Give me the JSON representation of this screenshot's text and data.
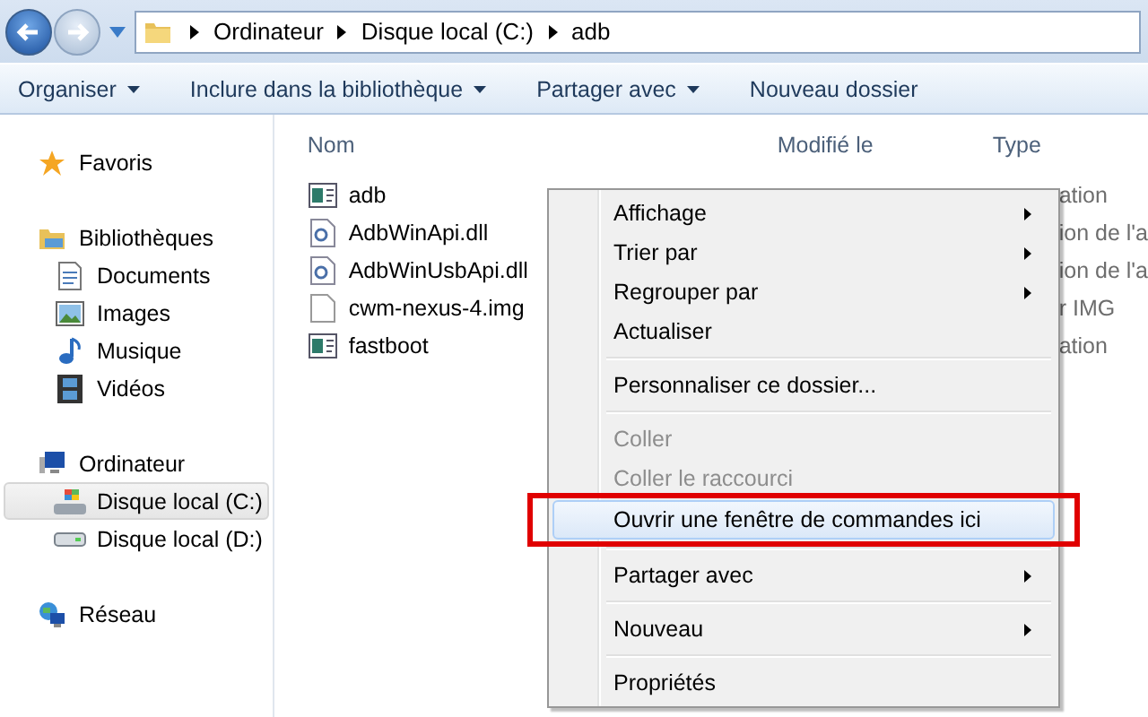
{
  "address_bar": {
    "crumbs": [
      "Ordinateur",
      "Disque local (C:)",
      "adb"
    ]
  },
  "toolbar": [
    {
      "label": "Organiser",
      "dropdown": true
    },
    {
      "label": "Inclure dans la bibliothèque",
      "dropdown": true
    },
    {
      "label": "Partager avec",
      "dropdown": true
    },
    {
      "label": "Nouveau dossier",
      "dropdown": false
    }
  ],
  "sidebar": {
    "groups": [
      {
        "label": "Favoris"
      },
      {
        "label": "Bibliothèques",
        "children": [
          {
            "label": "Documents",
            "selected": false
          },
          {
            "label": "Images",
            "selected": false
          },
          {
            "label": "Musique",
            "selected": false
          },
          {
            "label": "Vidéos",
            "selected": false
          }
        ]
      },
      {
        "label": "Ordinateur",
        "children": [
          {
            "label": "Disque local (C:)",
            "selected": true
          },
          {
            "label": "Disque local (D:)",
            "selected": false
          }
        ]
      },
      {
        "label": "Réseau"
      }
    ]
  },
  "table": {
    "columns": [
      "Nom",
      "Modifié le",
      "Type"
    ],
    "rows": [
      {
        "name": "adb",
        "kind": "application",
        "type": "ation"
      },
      {
        "name": "AdbWinApi.dll",
        "kind": "library",
        "type": "ion de l'a"
      },
      {
        "name": "AdbWinUsbApi.dll",
        "kind": "library",
        "type": "ion de l'a"
      },
      {
        "name": "cwm-nexus-4.img",
        "kind": "file",
        "type": "r IMG"
      },
      {
        "name": "fastboot",
        "kind": "application",
        "type": "ation"
      }
    ]
  },
  "context_menu": [
    {
      "kind": "item",
      "label": "Affichage",
      "submenu": true,
      "disabled": false,
      "selected": false,
      "annotated": false
    },
    {
      "kind": "item",
      "label": "Trier par",
      "submenu": true,
      "disabled": false,
      "selected": false,
      "annotated": false
    },
    {
      "kind": "item",
      "label": "Regrouper par",
      "submenu": true,
      "disabled": false,
      "selected": false,
      "annotated": false
    },
    {
      "kind": "item",
      "label": "Actualiser",
      "submenu": false,
      "disabled": false,
      "selected": false,
      "annotated": false
    },
    {
      "kind": "separator"
    },
    {
      "kind": "item",
      "label": "Personnaliser ce dossier...",
      "submenu": false,
      "disabled": false,
      "selected": false,
      "annotated": false
    },
    {
      "kind": "separator"
    },
    {
      "kind": "item",
      "label": "Coller",
      "submenu": false,
      "disabled": true,
      "selected": false,
      "annotated": false
    },
    {
      "kind": "item",
      "label": "Coller le raccourci",
      "submenu": false,
      "disabled": true,
      "selected": false,
      "annotated": false
    },
    {
      "kind": "item",
      "label": "Ouvrir une fenêtre de commandes ici",
      "submenu": false,
      "disabled": false,
      "selected": true,
      "annotated": true
    },
    {
      "kind": "separator"
    },
    {
      "kind": "item",
      "label": "Partager avec",
      "submenu": true,
      "disabled": false,
      "selected": false,
      "annotated": false
    },
    {
      "kind": "separator"
    },
    {
      "kind": "item",
      "label": "Nouveau",
      "submenu": true,
      "disabled": false,
      "selected": false,
      "annotated": false
    },
    {
      "kind": "separator"
    },
    {
      "kind": "item",
      "label": "Propriétés",
      "submenu": false,
      "disabled": false,
      "selected": false,
      "annotated": false
    }
  ]
}
